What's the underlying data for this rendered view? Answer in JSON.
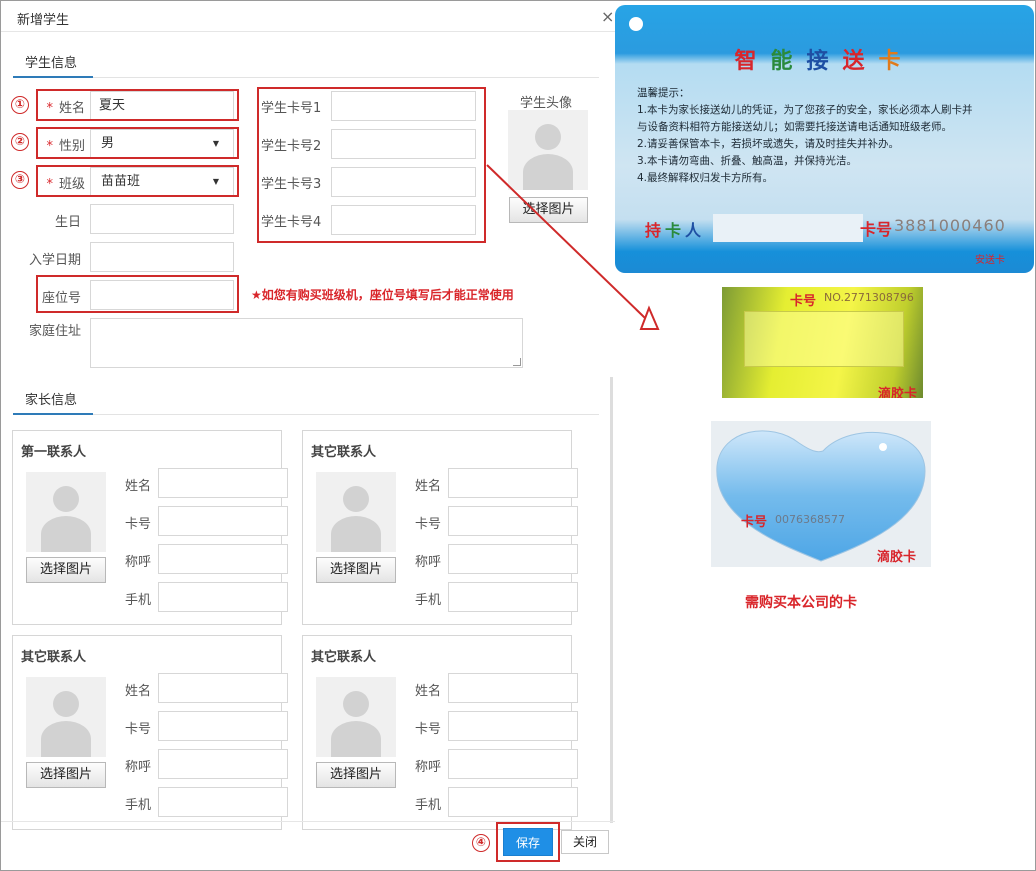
{
  "dialog": {
    "title": "新增学生",
    "close_icon": "×"
  },
  "student_section": {
    "title": "学生信息"
  },
  "parent_section": {
    "title": "家长信息"
  },
  "fields": {
    "name": {
      "label": "姓名",
      "value": "夏天"
    },
    "gender": {
      "label": "性别",
      "value": "男"
    },
    "class": {
      "label": "班级",
      "value": "苗苗班"
    },
    "birthday": {
      "label": "生日"
    },
    "enroll_date": {
      "label": "入学日期"
    },
    "seat_no": {
      "label": "座位号"
    },
    "address": {
      "label": "家庭住址"
    },
    "required_mark": "*",
    "caret": "▼"
  },
  "card_numbers": [
    {
      "label": "学生卡号1"
    },
    {
      "label": "学生卡号2"
    },
    {
      "label": "学生卡号3"
    },
    {
      "label": "学生卡号4"
    }
  ],
  "student_avatar": {
    "label": "学生头像",
    "button": "选择图片"
  },
  "annotations": {
    "badge1": "①",
    "badge2": "②",
    "badge3": "③",
    "badge4": "④",
    "seat_warning": "★如您有购买班级机，座位号填写后才能正常使用"
  },
  "contacts": [
    {
      "title": "第一联系人",
      "button": "选择图片",
      "fields": [
        "姓名",
        "卡号",
        "称呼",
        "手机"
      ]
    },
    {
      "title": "其它联系人",
      "button": "选择图片",
      "fields": [
        "姓名",
        "卡号",
        "称呼",
        "手机"
      ]
    },
    {
      "title": "其它联系人",
      "button": "选择图片",
      "fields": [
        "姓名",
        "卡号",
        "称呼",
        "手机"
      ]
    },
    {
      "title": "其它联系人",
      "button": "选择图片",
      "fields": [
        "姓名",
        "卡号",
        "称呼",
        "手机"
      ]
    }
  ],
  "footer": {
    "save": "保存",
    "close": "关闭"
  },
  "smart_card": {
    "brand_chars": [
      "智",
      "能",
      "接",
      "送",
      "卡"
    ],
    "brand_colors": [
      "#d8252b",
      "#2a8a3c",
      "#1e4fa3",
      "#d8252b",
      "#e07a1a"
    ],
    "tips": [
      "温馨提示：",
      "1.本卡为家长接送幼儿的凭证，为了您孩子的安全，家长必须本人刷卡并",
      "   与设备资料相符方能接送幼儿；如需要托接送请电话通知班级老师。",
      "2.请妥善保管本卡，若损坏或遗失，请及时挂失并补办。",
      "3.本卡请勿弯曲、折叠、触高温，并保持光洁。",
      "4.最终解释权归发卡方所有。"
    ],
    "holder_chars": [
      "持",
      "卡",
      "人"
    ],
    "card_no_label": "卡号",
    "card_no": "3881000460",
    "brand_small": "安送卡"
  },
  "glue_card_1": {
    "card_no_label": "卡号",
    "card_no": "NO.2771308796",
    "tag": "滴胶卡"
  },
  "glue_card_2": {
    "card_no_label": "卡号",
    "card_no": "0076368577",
    "tag": "滴胶卡"
  },
  "buy_note": "需购买本公司的卡",
  "colors": {
    "accent": "#1f8fe6",
    "annotation_red": "#cf2a2a",
    "tab_underline": "#2e7bb8"
  }
}
